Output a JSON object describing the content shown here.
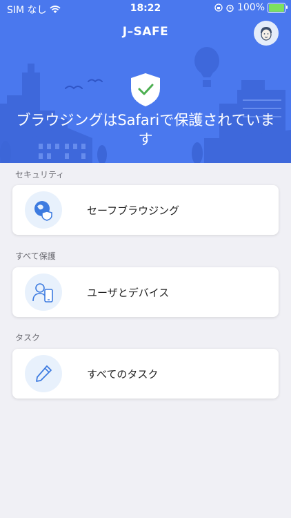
{
  "status_bar": {
    "carrier": "SIM なし",
    "time": "18:22",
    "battery": "100%",
    "battery_level": 1.0
  },
  "header": {
    "title": "J–SAFE",
    "avatar_icon": "avatar-face-icon"
  },
  "hero": {
    "message": "ブラウジングはSafariで保護されています",
    "icon": "shield-check-icon",
    "colors": {
      "background": "#4a78ee",
      "skyline": "#3c66d8",
      "check": "#4caf50"
    }
  },
  "sections": [
    {
      "title": "セキュリティ",
      "item": {
        "label": "セーフブラウジング",
        "icon": "globe-shield-icon"
      }
    },
    {
      "title": "すべて保護",
      "item": {
        "label": "ユーザとデバイス",
        "icon": "user-device-icon"
      }
    },
    {
      "title": "タスク",
      "item": {
        "label": "すべてのタスク",
        "icon": "pencil-icon"
      }
    }
  ]
}
